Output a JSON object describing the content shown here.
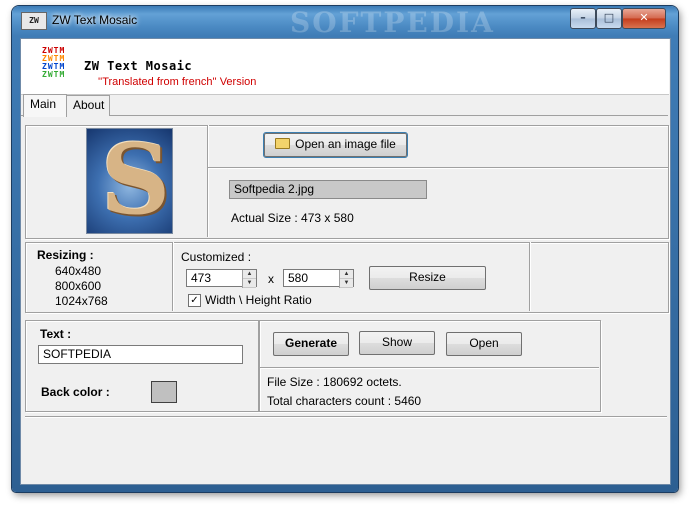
{
  "window": {
    "title": "ZW Text Mosaic",
    "icon_text": "ZW",
    "watermark": "SOFTPEDIA",
    "controls": [
      "minimize",
      "maximize",
      "close"
    ]
  },
  "header": {
    "logo_lines": [
      "ZWTM",
      "ZWTM",
      "ZWTM",
      "ZWTM"
    ],
    "logo_colors": [
      "#cc0000",
      "#ff8800",
      "#0044cc",
      "#33aa33"
    ],
    "app_name": "ZW Text Mosaic",
    "subtitle": "''Translated from french'' Version"
  },
  "tabs": [
    {
      "label": "Main",
      "active": true
    },
    {
      "label": "About",
      "active": false
    }
  ],
  "image_panel": {
    "thumbnail_letter": "S",
    "open_button": "Open an image file",
    "file_name": "Softpedia 2.jpg",
    "actual_size": "Actual Size : 473 x 580"
  },
  "resizing": {
    "title": "Resizing :",
    "presets": [
      "640x480",
      "800x600",
      "1024x768"
    ],
    "customized_label": "Customized :",
    "width": "473",
    "height": "580",
    "times": "x",
    "resize_button": "Resize",
    "ratio_label": "Width \\ Height Ratio",
    "ratio_checked": true
  },
  "text_panel": {
    "text_label": "Text :",
    "text_value": "SOFTPEDIA",
    "back_color_label": "Back color :",
    "back_color": "#c0c0c0"
  },
  "output_panel": {
    "generate": "Generate",
    "show": "Show",
    "open": "Open",
    "file_size": "File Size : 180692 octets.",
    "total_chars": "Total characters count : 5460"
  },
  "colors": {
    "accent": "#3c7fb1",
    "subtitle": "#d00000",
    "frame": "#4c8bc4"
  }
}
